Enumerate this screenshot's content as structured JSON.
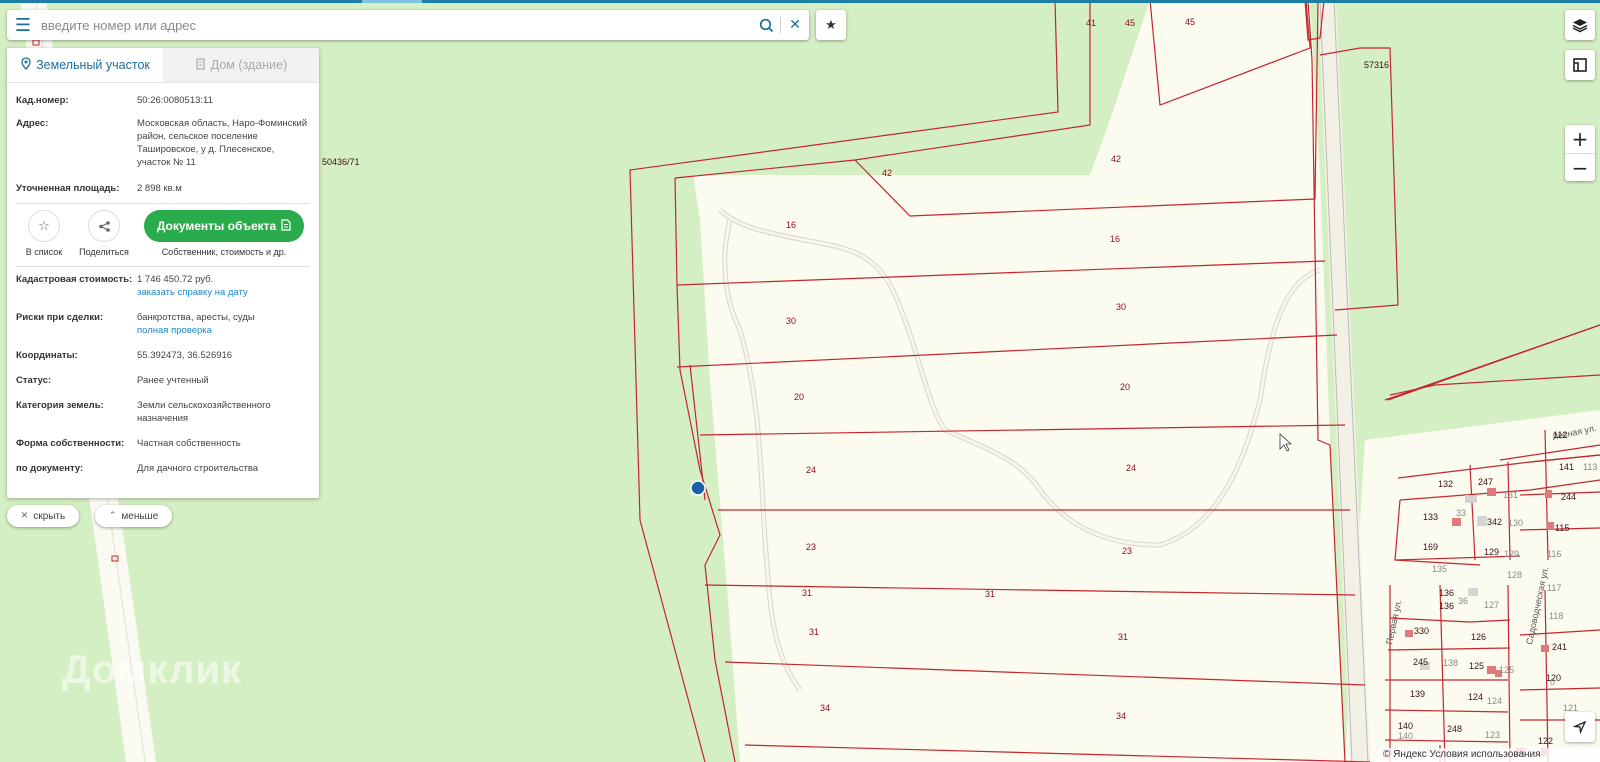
{
  "search": {
    "placeholder": "введите номер или адрес"
  },
  "tabs": [
    {
      "label": "Земельный участок",
      "active": true
    },
    {
      "label": "Дом (здание)",
      "active": false
    }
  ],
  "info": {
    "cad_label": "Кад.номер:",
    "cad_value": "50:26:0080513:11",
    "address_label": "Адрес:",
    "address_value": "Московская область, Наро-Фоминский район, сельское поселение Ташировское, у д. Плесенское, участок № 11",
    "area_label": "Уточненная площадь:",
    "area_value": "2 898 кв.м"
  },
  "actions": {
    "fav_label": "В список",
    "share_label": "Поделиться",
    "docs_label": "Документы объекта",
    "docs_sub": "Собственник, стоимость и др."
  },
  "details": {
    "cost_label": "Кадастровая стоимость:",
    "cost_value": "1 746 450.72 руб.",
    "cost_link": "заказать справку на дату",
    "risk_label": "Риски при сделки:",
    "risk_value": "банкротства, аресты, суды",
    "risk_link": "полная проверка",
    "coords_label": "Координаты:",
    "coords_value": "55.392473, 36.526916",
    "status_label": "Статус:",
    "status_value": "Ранее учтенный",
    "category_label": "Категория земель:",
    "category_value": "Земли сельскохозяйственного назначения",
    "ownership_label": "Форма собственности:",
    "ownership_value": "Частная собственность",
    "document_label": "по документу:",
    "document_value": "Для дачного строительства"
  },
  "pills": {
    "hide": "скрыть",
    "less": "меньше"
  },
  "watermark": "Домклик",
  "copyright": "© Яндекс Условия использования",
  "map_labels": {
    "plots": [
      "41",
      "45",
      "42",
      "42",
      "16",
      "16",
      "30",
      "30",
      "20",
      "20",
      "24",
      "24",
      "23",
      "23",
      "31",
      "31",
      "31",
      "31",
      "34",
      "34"
    ],
    "cadastral": [
      "50436/71",
      "57316"
    ],
    "houses": [
      "112",
      "141",
      "113",
      "132",
      "247",
      "131",
      "244",
      "133",
      "133",
      "342",
      "130",
      "115",
      "169",
      "129",
      "116",
      "135",
      "128",
      "117",
      "136",
      "136",
      "36",
      "127",
      "118",
      "330",
      "126",
      "241",
      "245",
      "138",
      "125",
      "125",
      "120",
      "139",
      "124",
      "124",
      "121",
      "140",
      "140",
      "248",
      "123",
      "122"
    ],
    "streets": [
      "Лесная ул.",
      "Садоводческая ул.",
      "Первая ул."
    ]
  },
  "colors": {
    "accent": "#1d6e9c",
    "docs_button": "#2bac4c",
    "boundary": "#c4262e",
    "grass": "#d5efc4",
    "plot_fill": "#fcfbef"
  }
}
